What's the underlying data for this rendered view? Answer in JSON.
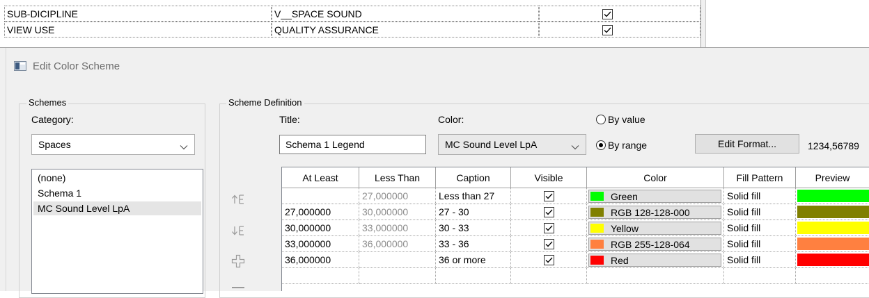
{
  "properties": {
    "rows": [
      {
        "name": "SUB-DICIPLINE",
        "value": "V__SPACE SOUND",
        "checked": true
      },
      {
        "name": "VIEW USE",
        "value": "QUALITY ASSURANCE",
        "checked": true
      }
    ]
  },
  "dialog": {
    "title": "Edit Color Scheme",
    "schemes": {
      "group_label": "Schemes",
      "category_label": "Category:",
      "category_value": "Spaces",
      "items": [
        "(none)",
        "Schema 1",
        "MC Sound Level LpA"
      ],
      "selected_index": 2
    },
    "definition": {
      "group_label": "Scheme Definition",
      "title_label": "Title:",
      "title_value": "Schema 1 Legend",
      "color_label": "Color:",
      "color_value": "MC Sound Level LpA",
      "by_value_label": "By value",
      "by_range_label": "By range",
      "by_range_selected": true,
      "edit_format_label": "Edit Format...",
      "format_sample": "1234,56789",
      "side_icons": [
        "move-up-icon",
        "move-down-icon",
        "add-row-icon"
      ],
      "grid": {
        "headers": [
          "At Least",
          "Less Than",
          "Caption",
          "Visible",
          "Color",
          "Fill Pattern",
          "Preview"
        ],
        "rows": [
          {
            "at_least": "",
            "less_than": "27,000000",
            "caption": "Less than 27",
            "visible": true,
            "color_name": "Green",
            "color": "#00ff00",
            "fill": "Solid fill"
          },
          {
            "at_least": "27,000000",
            "less_than": "30,000000",
            "caption": "27 - 30",
            "visible": true,
            "color_name": "RGB 128-128-000",
            "color": "#808000",
            "fill": "Solid fill"
          },
          {
            "at_least": "30,000000",
            "less_than": "33,000000",
            "caption": "30 - 33",
            "visible": true,
            "color_name": "Yellow",
            "color": "#ffff00",
            "fill": "Solid fill"
          },
          {
            "at_least": "33,000000",
            "less_than": "36,000000",
            "caption": "33 - 36",
            "visible": true,
            "color_name": "RGB 255-128-064",
            "color": "#ff8040",
            "fill": "Solid fill"
          },
          {
            "at_least": "36,000000",
            "less_than": "",
            "caption": "36 or more",
            "visible": true,
            "color_name": "Red",
            "color": "#ff0000",
            "fill": "Solid fill"
          }
        ]
      }
    }
  }
}
